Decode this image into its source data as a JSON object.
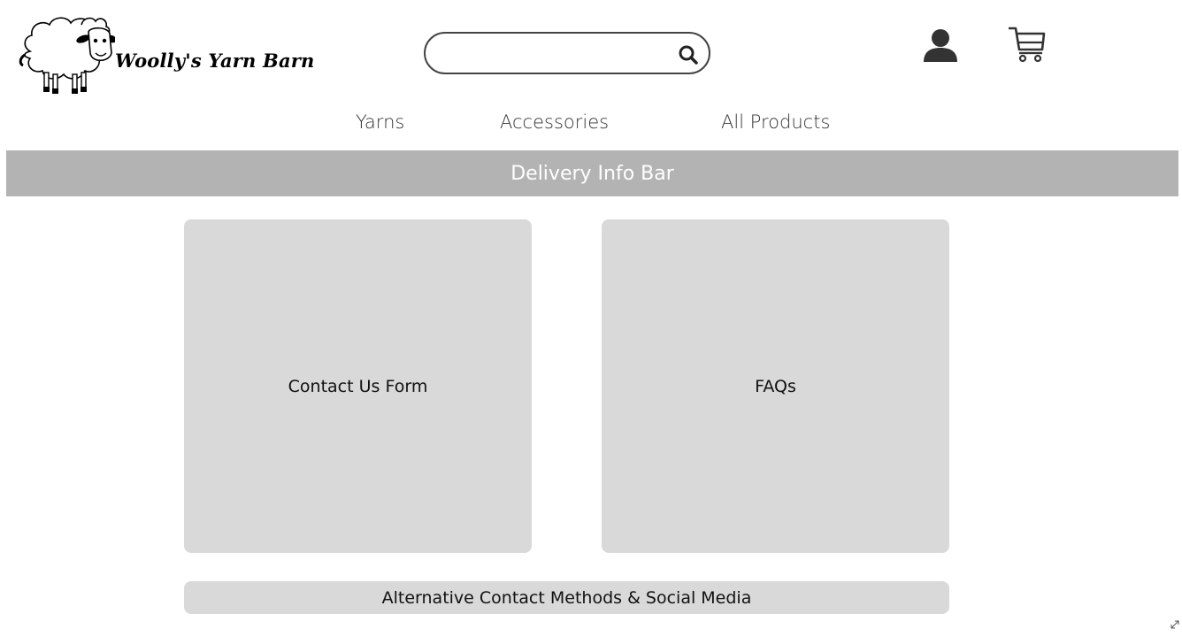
{
  "header": {
    "logo_text": "Woolly's Yarn Barn",
    "search": {
      "value": "",
      "placeholder": ""
    },
    "icons": {
      "search": "search-icon",
      "account": "user-icon",
      "cart": "cart-icon"
    }
  },
  "nav": {
    "items": [
      {
        "label": "Yarns"
      },
      {
        "label": "Accessories"
      },
      {
        "label": "All Products"
      }
    ]
  },
  "delivery_bar": {
    "label": "Delivery Info Bar"
  },
  "main": {
    "contact_form": {
      "label": "Contact Us Form"
    },
    "faqs": {
      "label": "FAQs"
    },
    "alt_contact": {
      "label": "Alternative Contact Methods & Social Media"
    }
  },
  "colors": {
    "delivery_bar_bg": "#b3b3b3",
    "panel_bg": "#d9d9d9",
    "icon_dark": "#333333"
  }
}
